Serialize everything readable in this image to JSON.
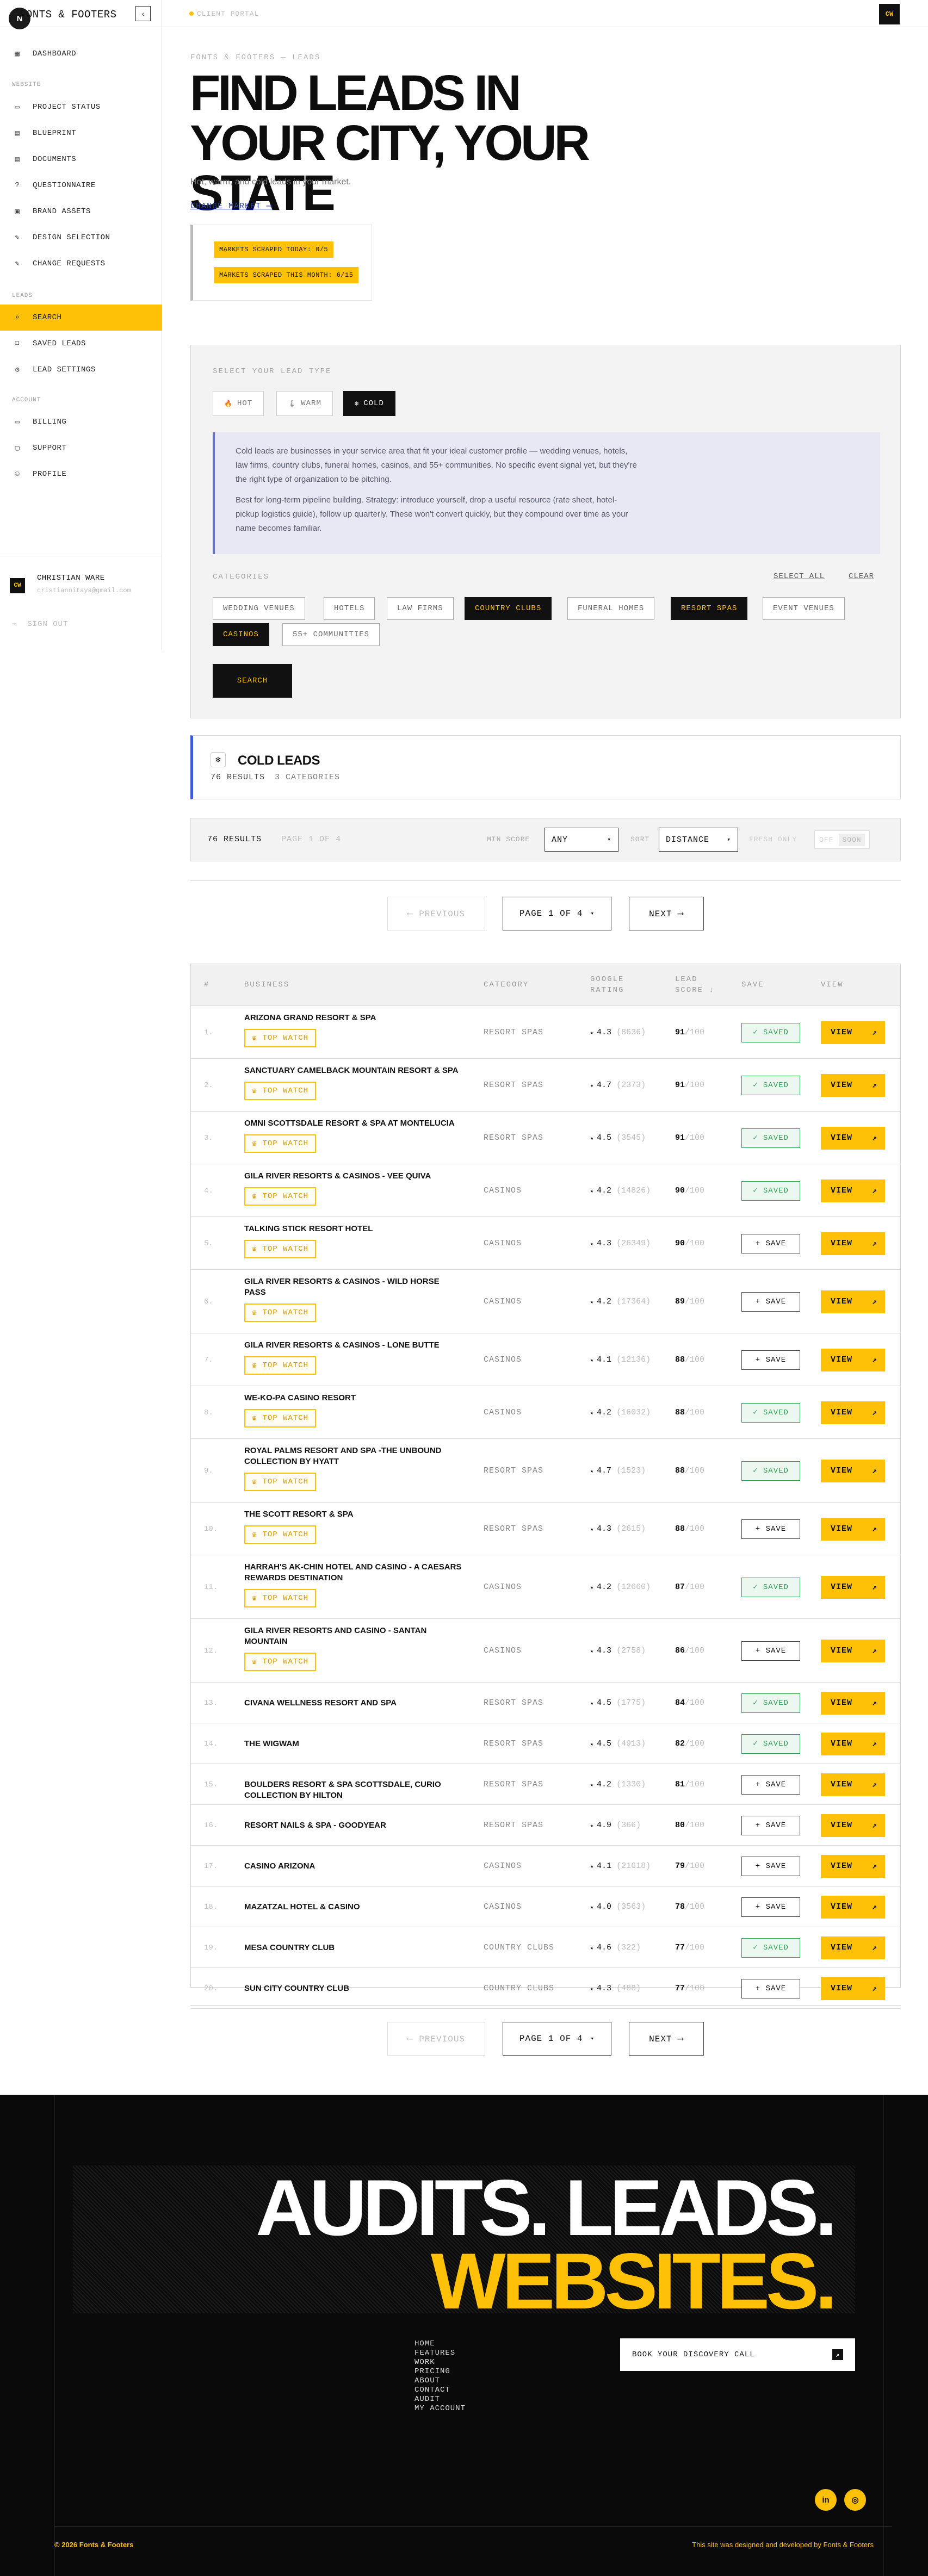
{
  "sidebar": {
    "logo": "N",
    "brand": "FONTS & FOOTERS",
    "collapse_icon": "‹",
    "nav_top": [
      {
        "label": "DASHBOARD",
        "icon": "grid-icon",
        "glyph": "▦"
      }
    ],
    "section_website": "WEBSITE",
    "website_items": [
      {
        "label": "PROJECT STATUS",
        "icon": "monitor-icon",
        "glyph": "▭"
      },
      {
        "label": "BLUEPRINT",
        "icon": "file-icon",
        "glyph": "▤"
      },
      {
        "label": "DOCUMENTS",
        "icon": "folder-icon",
        "glyph": "▤"
      },
      {
        "label": "QUESTIONNAIRE",
        "icon": "help-icon",
        "glyph": "?"
      },
      {
        "label": "BRAND ASSETS",
        "icon": "image-icon",
        "glyph": "▣"
      },
      {
        "label": "DESIGN SELECTION",
        "icon": "palette-icon",
        "glyph": "✎"
      },
      {
        "label": "CHANGE REQUESTS",
        "icon": "edit-icon",
        "glyph": "✎"
      }
    ],
    "section_leads": "LEADS",
    "lead_items": [
      {
        "label": "SEARCH",
        "icon": "search-icon",
        "glyph": "⌕"
      },
      {
        "label": "SAVED LEADS",
        "icon": "bookmark-icon",
        "glyph": "⌑"
      },
      {
        "label": "LEAD SETTINGS",
        "icon": "gear-icon",
        "glyph": "⚙"
      }
    ],
    "section_account": "ACCOUNT",
    "account_items": [
      {
        "label": "BILLING",
        "icon": "card-icon",
        "glyph": "▭"
      },
      {
        "label": "SUPPORT",
        "icon": "chat-icon",
        "glyph": "▢"
      },
      {
        "label": "PROFILE",
        "icon": "user-icon",
        "glyph": "☺"
      }
    ],
    "user": {
      "initials": "CW",
      "name": "CHRISTIAN WARE",
      "email": "cristiannitaya@gmail.com",
      "signout": "SIGN OUT"
    }
  },
  "topbar": {
    "portal": "CLIENT PORTAL",
    "avatar": "CW"
  },
  "hero": {
    "eyebrow": "FONTS & FOOTERS — LEADS",
    "title_l1": "FIND LEADS IN",
    "title_l2": "YOUR CITY, YOUR STATE",
    "subtitle": "Hot, warm, and cold leads in your market.",
    "change_market": "CHANGE MARKET  ⟶",
    "stat_today": "MARKETS SCRAPED TODAY: 0/5",
    "stat_month": "MARKETS SCRAPED THIS MONTH: 6/15"
  },
  "search": {
    "type_label": "SELECT YOUR LEAD TYPE",
    "types": [
      {
        "label": "HOT",
        "glyph": "🔥",
        "icon": "flame-icon",
        "active": false
      },
      {
        "label": "WARM",
        "glyph": "🌡",
        "icon": "thermometer-icon",
        "active": false
      },
      {
        "label": "COLD",
        "glyph": "❄",
        "icon": "snowflake-icon",
        "active": true
      }
    ],
    "info_p1": "Cold leads are businesses in your service area that fit your ideal customer profile — wedding venues, hotels, law firms, country clubs, funeral homes, casinos, and 55+ communities. No specific event signal yet, but they're the right type of organization to be pitching.",
    "info_p2": "Best for long-term pipeline building. Strategy: introduce yourself, drop a useful resource (rate sheet, hotel-pickup logistics guide), follow up quarterly. These won't convert quickly, but they compound over time as your name becomes familiar.",
    "categories_label": "CATEGORIES",
    "select_all": "SELECT ALL",
    "clear": "CLEAR",
    "categories": [
      {
        "label": "WEDDING VENUES",
        "active": false
      },
      {
        "label": "HOTELS",
        "active": false
      },
      {
        "label": "LAW FIRMS",
        "active": false
      },
      {
        "label": "COUNTRY CLUBS",
        "active": true
      },
      {
        "label": "FUNERAL HOMES",
        "active": false
      },
      {
        "label": "RESORT SPAS",
        "active": true
      },
      {
        "label": "EVENT VENUES",
        "active": false
      },
      {
        "label": "CASINOS",
        "active": true
      },
      {
        "label": "55+ COMMUNITIES",
        "active": false
      }
    ],
    "search_button": "SEARCH"
  },
  "results": {
    "icon": "snowflake-icon",
    "glyph": "❄",
    "title": "COLD LEADS",
    "count": "76 RESULTS",
    "categories": "3 CATEGORIES",
    "summary": "76 RESULTS",
    "page_info": "PAGE 1 OF 4",
    "min_score_label": "MIN SCORE",
    "min_score_value": "ANY",
    "sort_label": "SORT",
    "sort_value": "DISTANCE",
    "fresh_label": "FRESH ONLY",
    "fresh_off": "OFF",
    "fresh_soon": "SOON"
  },
  "pagination": {
    "previous": "⟵  PREVIOUS",
    "page": "PAGE 1 OF 4",
    "next": "NEXT  ⟶"
  },
  "table": {
    "headers": {
      "num": "#",
      "business": "BUSINESS",
      "category": "CATEGORY",
      "rating_l1": "GOOGLE",
      "rating_l2": "RATING",
      "score_l1": "LEAD",
      "score_l2": "SCORE ↓",
      "save": "SAVE",
      "view": "VIEW"
    },
    "top_watch": "TOP WATCH",
    "saved_label": "✓ SAVED",
    "save_label": "+ SAVE",
    "view_label": "VIEW",
    "score_of": "/100",
    "rows": [
      {
        "n": "1.",
        "name": "ARIZONA GRAND RESORT & SPA",
        "top": true,
        "category": "RESORT SPAS",
        "rating": "4.3",
        "reviews": "(8636)",
        "score": "91",
        "saved": true
      },
      {
        "n": "2.",
        "name": "SANCTUARY CAMELBACK MOUNTAIN RESORT & SPA",
        "top": true,
        "category": "RESORT SPAS",
        "rating": "4.7",
        "reviews": "(2373)",
        "score": "91",
        "saved": true
      },
      {
        "n": "3.",
        "name": "OMNI SCOTTSDALE RESORT & SPA AT MONTELUCIA",
        "top": true,
        "category": "RESORT SPAS",
        "rating": "4.5",
        "reviews": "(3545)",
        "score": "91",
        "saved": true
      },
      {
        "n": "4.",
        "name": "GILA RIVER RESORTS & CASINOS - VEE QUIVA",
        "top": true,
        "category": "CASINOS",
        "rating": "4.2",
        "reviews": "(14826)",
        "score": "90",
        "saved": true
      },
      {
        "n": "5.",
        "name": "TALKING STICK RESORT HOTEL",
        "top": true,
        "category": "CASINOS",
        "rating": "4.3",
        "reviews": "(26349)",
        "score": "90",
        "saved": false
      },
      {
        "n": "6.",
        "name": "GILA RIVER RESORTS & CASINOS - WILD HORSE PASS",
        "top": true,
        "category": "CASINOS",
        "rating": "4.2",
        "reviews": "(17364)",
        "score": "89",
        "saved": false
      },
      {
        "n": "7.",
        "name": "GILA RIVER RESORTS & CASINOS - LONE BUTTE",
        "top": true,
        "category": "CASINOS",
        "rating": "4.1",
        "reviews": "(12136)",
        "score": "88",
        "saved": false
      },
      {
        "n": "8.",
        "name": "WE-KO-PA CASINO RESORT",
        "top": true,
        "category": "CASINOS",
        "rating": "4.2",
        "reviews": "(16032)",
        "score": "88",
        "saved": true
      },
      {
        "n": "9.",
        "name": "ROYAL PALMS RESORT AND SPA -THE UNBOUND COLLECTION BY HYATT",
        "top": true,
        "category": "RESORT SPAS",
        "rating": "4.7",
        "reviews": "(1523)",
        "score": "88",
        "saved": true
      },
      {
        "n": "10.",
        "name": "THE SCOTT RESORT & SPA",
        "top": true,
        "category": "RESORT SPAS",
        "rating": "4.3",
        "reviews": "(2615)",
        "score": "88",
        "saved": false
      },
      {
        "n": "11.",
        "name": "HARRAH'S AK-CHIN HOTEL AND CASINO - A CAESARS REWARDS DESTINATION",
        "top": true,
        "category": "CASINOS",
        "rating": "4.2",
        "reviews": "(12660)",
        "score": "87",
        "saved": true
      },
      {
        "n": "12.",
        "name": "GILA RIVER RESORTS AND CASINO - SANTAN MOUNTAIN",
        "top": true,
        "category": "CASINOS",
        "rating": "4.3",
        "reviews": "(2758)",
        "score": "86",
        "saved": false
      },
      {
        "n": "13.",
        "name": "CIVANA WELLNESS RESORT AND SPA",
        "top": false,
        "category": "RESORT SPAS",
        "rating": "4.5",
        "reviews": "(1775)",
        "score": "84",
        "saved": true
      },
      {
        "n": "14.",
        "name": "THE WIGWAM",
        "top": false,
        "category": "RESORT SPAS",
        "rating": "4.5",
        "reviews": "(4913)",
        "score": "82",
        "saved": true
      },
      {
        "n": "15.",
        "name": "BOULDERS RESORT & SPA SCOTTSDALE, CURIO COLLECTION BY HILTON",
        "top": false,
        "category": "RESORT SPAS",
        "rating": "4.2",
        "reviews": "(1330)",
        "score": "81",
        "saved": false
      },
      {
        "n": "16.",
        "name": "RESORT NAILS & SPA - GOODYEAR",
        "top": false,
        "category": "RESORT SPAS",
        "rating": "4.9",
        "reviews": "(366)",
        "score": "80",
        "saved": false
      },
      {
        "n": "17.",
        "name": "CASINO ARIZONA",
        "top": false,
        "category": "CASINOS",
        "rating": "4.1",
        "reviews": "(21618)",
        "score": "79",
        "saved": false
      },
      {
        "n": "18.",
        "name": "MAZATZAL HOTEL & CASINO",
        "top": false,
        "category": "CASINOS",
        "rating": "4.0",
        "reviews": "(3563)",
        "score": "78",
        "saved": false
      },
      {
        "n": "19.",
        "name": "MESA COUNTRY CLUB",
        "top": false,
        "category": "COUNTRY CLUBS",
        "rating": "4.6",
        "reviews": "(322)",
        "score": "77",
        "saved": true
      },
      {
        "n": "20.",
        "name": "SUN CITY COUNTRY CLUB",
        "top": false,
        "category": "COUNTRY CLUBS",
        "rating": "4.3",
        "reviews": "(488)",
        "score": "77",
        "saved": false
      }
    ]
  },
  "footer": {
    "line1": "AUDITS. LEADS.",
    "line2": "WEBSITES.",
    "links": [
      "HOME",
      "FEATURES",
      "WORK",
      "PRICING",
      "ABOUT",
      "CONTACT",
      "AUDIT",
      "MY ACCOUNT"
    ],
    "book": "BOOK YOUR DISCOVERY CALL",
    "social": [
      {
        "icon": "linkedin-icon",
        "glyph": "in"
      },
      {
        "icon": "instagram-icon",
        "glyph": "◎"
      }
    ],
    "copyright": "© 2026 Fonts & Footers",
    "credit": "This site was designed and developed by Fonts & Footers"
  },
  "colors": {
    "accent": "#ffc107",
    "dark": "#111111",
    "saved": "#2f9e55",
    "info_bg": "#e7e8f3",
    "link": "#2c3fb6"
  }
}
